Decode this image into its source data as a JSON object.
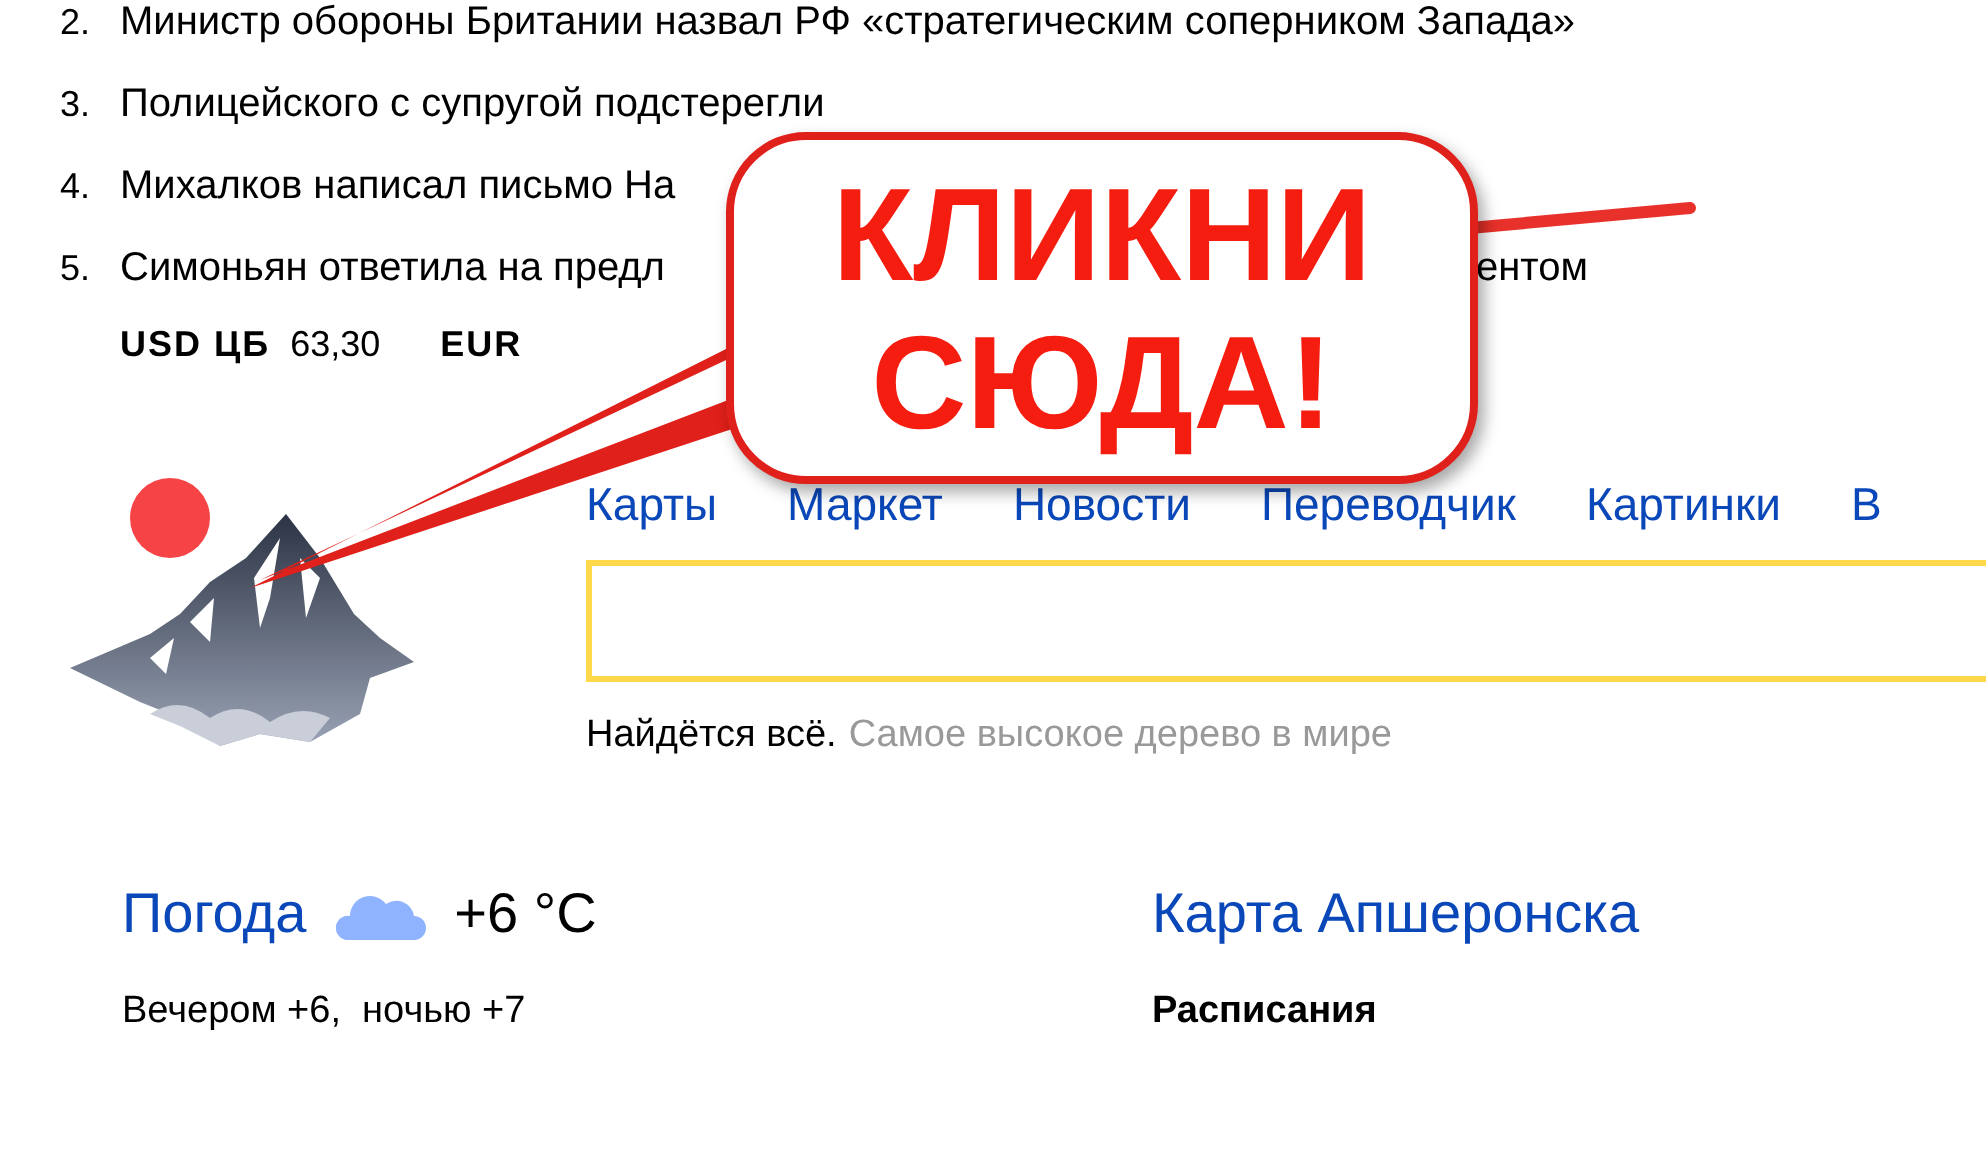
{
  "news": [
    {
      "number": "2.",
      "text": "Министр обороны Британии назвал РФ «стратегическим соперником Запада»"
    },
    {
      "number": "3.",
      "text": "Полицейского с супругой подстерегли"
    },
    {
      "number": "4.",
      "text": "Михалков написал письмо На"
    },
    {
      "number": "5.",
      "text": "Симоньян ответила на предл",
      "tail": "ентом"
    }
  ],
  "currency": [
    {
      "code": "USD ЦБ",
      "value": "63,30"
    },
    {
      "code": "EUR"
    }
  ],
  "callout": {
    "lines": [
      "КЛИКНИ",
      "СЮДА!"
    ]
  },
  "nav": [
    "Карты",
    "Маркет",
    "Новости",
    "Переводчик",
    "Картинки",
    "В"
  ],
  "search_hint": {
    "lead": "Найдётся всё.",
    "example": "Самое высокое дерево в мире"
  },
  "weather": {
    "title": "Погода",
    "temperature": "+6 °C",
    "forecast": "Вечером +6,  ночью +7"
  },
  "map": {
    "title": "Карта Апшеронска",
    "section": "Расписания"
  }
}
